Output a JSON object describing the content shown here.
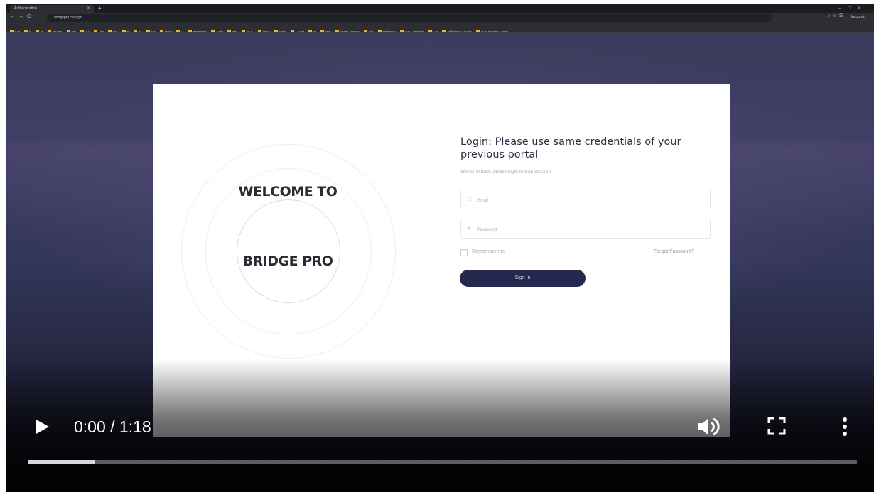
{
  "browser": {
    "tab_title": "Authentication",
    "url": "bridgepro.ca/login",
    "profile_label": "Incognito",
    "bookmarks": [
      "CM",
      "F",
      "M",
      "WORK",
      "MP",
      "TT",
      "DM",
      "GR",
      "P",
      "SL",
      "EX",
      "HRD",
      "IT",
      "Requests",
      "Tools",
      "MP",
      "POC",
      "Docs",
      "PHM",
      "Cloud",
      "IP",
      "HW",
      "Super reports",
      "MP",
      "Hellosign",
      "GET Updates",
      "CF",
      "SkillShop Google",
      "Google Web Desig..."
    ]
  },
  "card": {
    "welcome_line1": "WELCOME TO",
    "welcome_line2": "BRIDGE PRO",
    "login_title": "Login: Please use same credentials of your previous portal",
    "login_subtitle": "Welcome back, please login to your account.",
    "email_placeholder": "Email",
    "password_placeholder": "Password",
    "remember_label": "Remember me",
    "forgot_label": "Forgot Password?",
    "signin_label": "Sign In"
  },
  "player": {
    "timecode": "0:00 / 1:18",
    "progress_fraction": 0.08,
    "play_icon": "play-icon",
    "volume_icon": "volume-icon",
    "fullscreen_icon": "fullscreen-icon",
    "more_icon": "more-vert-icon"
  }
}
